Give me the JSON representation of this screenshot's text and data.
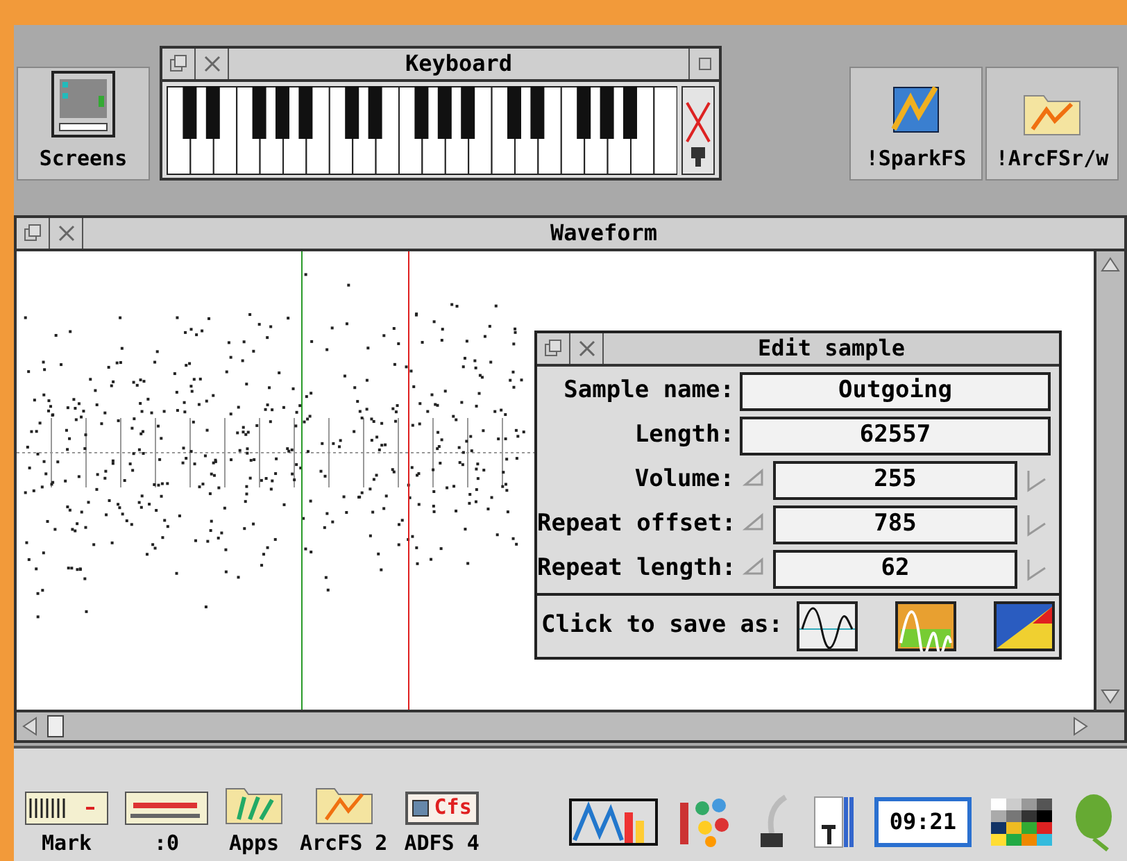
{
  "keyboard_window": {
    "title": "Keyboard"
  },
  "desktop_icons": [
    {
      "label": "Screens",
      "kind": "screens"
    },
    {
      "label": "!SparkFS",
      "kind": "spark"
    },
    {
      "label": "!ArcFSr/w",
      "kind": "folder"
    }
  ],
  "waveform_window": {
    "title": "Waveform"
  },
  "edit_sample": {
    "title": "Edit sample",
    "fields": [
      {
        "label": "Sample name:",
        "value": "Outgoing",
        "kind": "text"
      },
      {
        "label": "Length:",
        "value": "62557",
        "kind": "text"
      },
      {
        "label": "Volume:",
        "value": "255",
        "kind": "spin"
      },
      {
        "label": "Repeat offset:",
        "value": "785",
        "kind": "spin"
      },
      {
        "label": "Repeat length:",
        "value": "62",
        "kind": "spin"
      }
    ],
    "save_label": "Click to save as:"
  },
  "icon_bar": [
    {
      "label": "Mark",
      "kind": "mark"
    },
    {
      "label": ":0",
      "kind": "meter"
    },
    {
      "label": "Apps",
      "kind": "apps"
    },
    {
      "label": "ArcFS 2",
      "kind": "arcfs"
    },
    {
      "label": "ADFS 4",
      "kind": "cfs",
      "badge": "Cfs"
    },
    {
      "kind": "chart"
    },
    {
      "kind": "paint"
    },
    {
      "kind": "pen"
    },
    {
      "kind": "text"
    },
    {
      "label": "09:21",
      "kind": "clock"
    },
    {
      "kind": "palette"
    },
    {
      "kind": "acorn"
    }
  ]
}
